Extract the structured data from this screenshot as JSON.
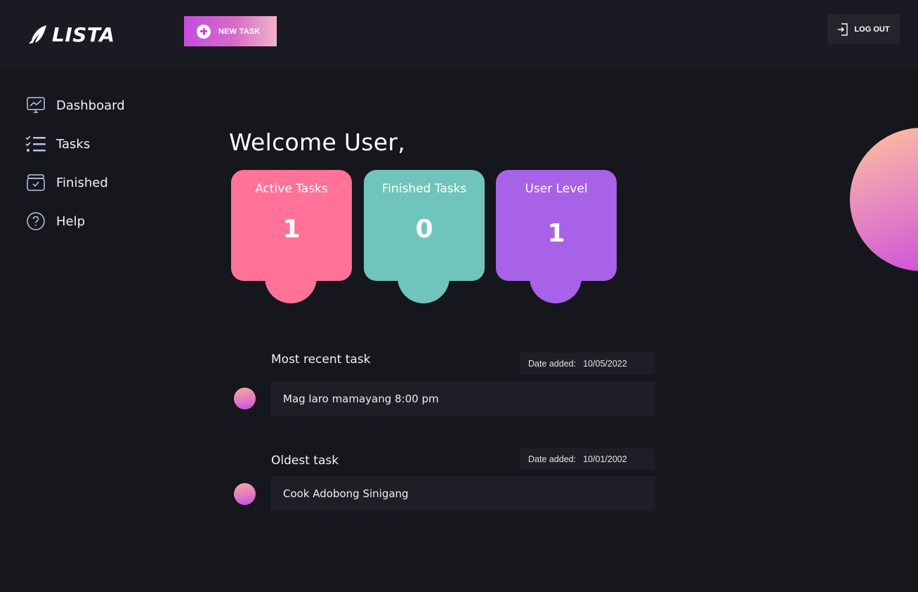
{
  "app": {
    "name": "LISTA"
  },
  "header": {
    "new_task_label": "NEW TASK",
    "logout_label": "LOG OUT"
  },
  "sidebar": {
    "items": [
      {
        "label": "Dashboard",
        "icon": "dashboard-chart-icon"
      },
      {
        "label": "Tasks",
        "icon": "checklist-icon"
      },
      {
        "label": "Finished",
        "icon": "archive-box-icon"
      },
      {
        "label": "Help",
        "icon": "help-circle-icon"
      }
    ]
  },
  "main": {
    "welcome": "Welcome User,",
    "stats": [
      {
        "title": "Active Tasks",
        "value": "1",
        "color": "#ff7398"
      },
      {
        "title": "Finished Tasks",
        "value": "0",
        "color": "#6fc5bb"
      },
      {
        "title": "User Level",
        "value": "1",
        "color": "#a862e8"
      }
    ],
    "recent": {
      "title": "Most recent task",
      "date_label": "Date added:",
      "date_value": "10/05/2022",
      "task": "Mag laro mamayang 8:00 pm"
    },
    "oldest": {
      "title": "Oldest task",
      "date_label": "Date added:",
      "date_value": "10/01/2002",
      "task": "Cook Adobong Sinigang"
    }
  },
  "colors": {
    "background": "#16161d",
    "topbar": "#1a1a22",
    "accent_gradient_start": "#c34de0",
    "accent_gradient_end": "#f0b4c9"
  }
}
